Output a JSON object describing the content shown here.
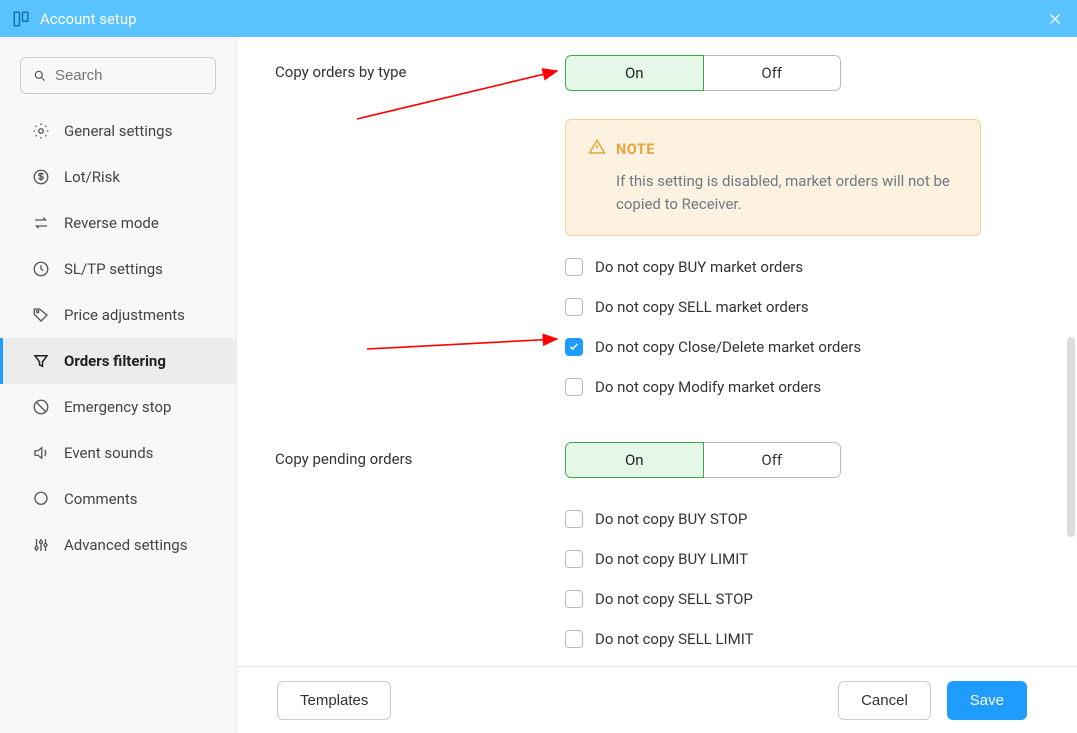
{
  "title": "Account setup",
  "search": {
    "placeholder": "Search"
  },
  "sidebar": {
    "items": [
      {
        "label": "General settings",
        "icon": "gear"
      },
      {
        "label": "Lot/Risk",
        "icon": "dollar"
      },
      {
        "label": "Reverse mode",
        "icon": "swap"
      },
      {
        "label": "SL/TP settings",
        "icon": "clock"
      },
      {
        "label": "Price adjustments",
        "icon": "tag"
      },
      {
        "label": "Orders filtering",
        "icon": "filter",
        "active": true
      },
      {
        "label": "Emergency stop",
        "icon": "forbid"
      },
      {
        "label": "Event sounds",
        "icon": "sound"
      },
      {
        "label": "Comments",
        "icon": "chat"
      },
      {
        "label": "Advanced settings",
        "icon": "sliders"
      }
    ]
  },
  "sections": {
    "copy_orders_by_type": {
      "label": "Copy orders by type",
      "toggle": {
        "on": "On",
        "off": "Off",
        "value": "On"
      },
      "note": {
        "title": "NOTE",
        "text": "If this setting is disabled, market orders will not be copied to Receiver."
      },
      "checks": [
        {
          "label": "Do not copy BUY market orders",
          "checked": false
        },
        {
          "label": "Do not copy SELL market orders",
          "checked": false
        },
        {
          "label": "Do not copy Close/Delete market orders",
          "checked": true
        },
        {
          "label": "Do not copy Modify market orders",
          "checked": false
        }
      ]
    },
    "copy_pending_orders": {
      "label": "Copy pending orders",
      "toggle": {
        "on": "On",
        "off": "Off",
        "value": "On"
      },
      "checks": [
        {
          "label": "Do not copy BUY STOP",
          "checked": false
        },
        {
          "label": "Do not copy BUY LIMIT",
          "checked": false
        },
        {
          "label": "Do not copy SELL STOP",
          "checked": false
        },
        {
          "label": "Do not copy SELL LIMIT",
          "checked": false
        }
      ]
    }
  },
  "footer": {
    "templates": "Templates",
    "cancel": "Cancel",
    "save": "Save"
  }
}
